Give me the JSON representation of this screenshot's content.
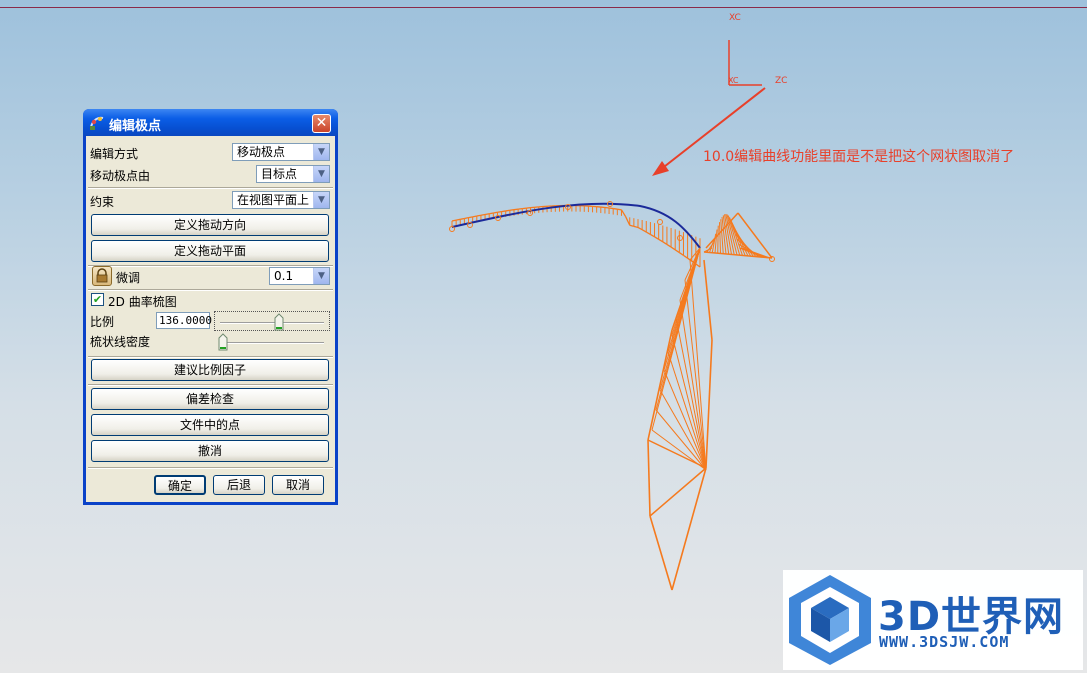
{
  "window": {
    "title": "编辑极点",
    "close_label": "✕"
  },
  "form": {
    "edit_method_label": "编辑方式",
    "edit_method_value": "移动极点",
    "move_pole_by_label": "移动极点由",
    "move_pole_by_value": "目标点",
    "constraint_label": "约束",
    "constraint_value": "在视图平面上",
    "define_drag_direction": "定义拖动方向",
    "define_drag_plane": "定义拖动平面",
    "fine_tune_label": "微调",
    "fine_tune_value": "0.1",
    "curvature_comb_label": "2D 曲率梳图",
    "curvature_comb_checked": true,
    "scale_label": "比例",
    "scale_value": "136.0000",
    "scale_slider_fraction": 0.57,
    "comb_density_label": "梳状线密度",
    "comb_density_slider_fraction": 0.0,
    "suggest_scale_factor": "建议比例因子",
    "deviation_check": "偏差检查",
    "points_in_file": "文件中的点",
    "undo": "撤消",
    "ok": "确定",
    "back": "后退",
    "cancel": "取消"
  },
  "viewport": {
    "annotation": "10.0编辑曲线功能里面是不是把这个网状图取消了",
    "axis_xc_top": "XC",
    "axis_xc_small": "XC",
    "axis_zc": "ZC",
    "curve_color": "#f57a1e",
    "annotation_color": "#e8402a"
  },
  "watermark": {
    "title": "3D世界网",
    "url": "WWW.3DSJW.COM",
    "brand_color": "#1f5fb7"
  }
}
